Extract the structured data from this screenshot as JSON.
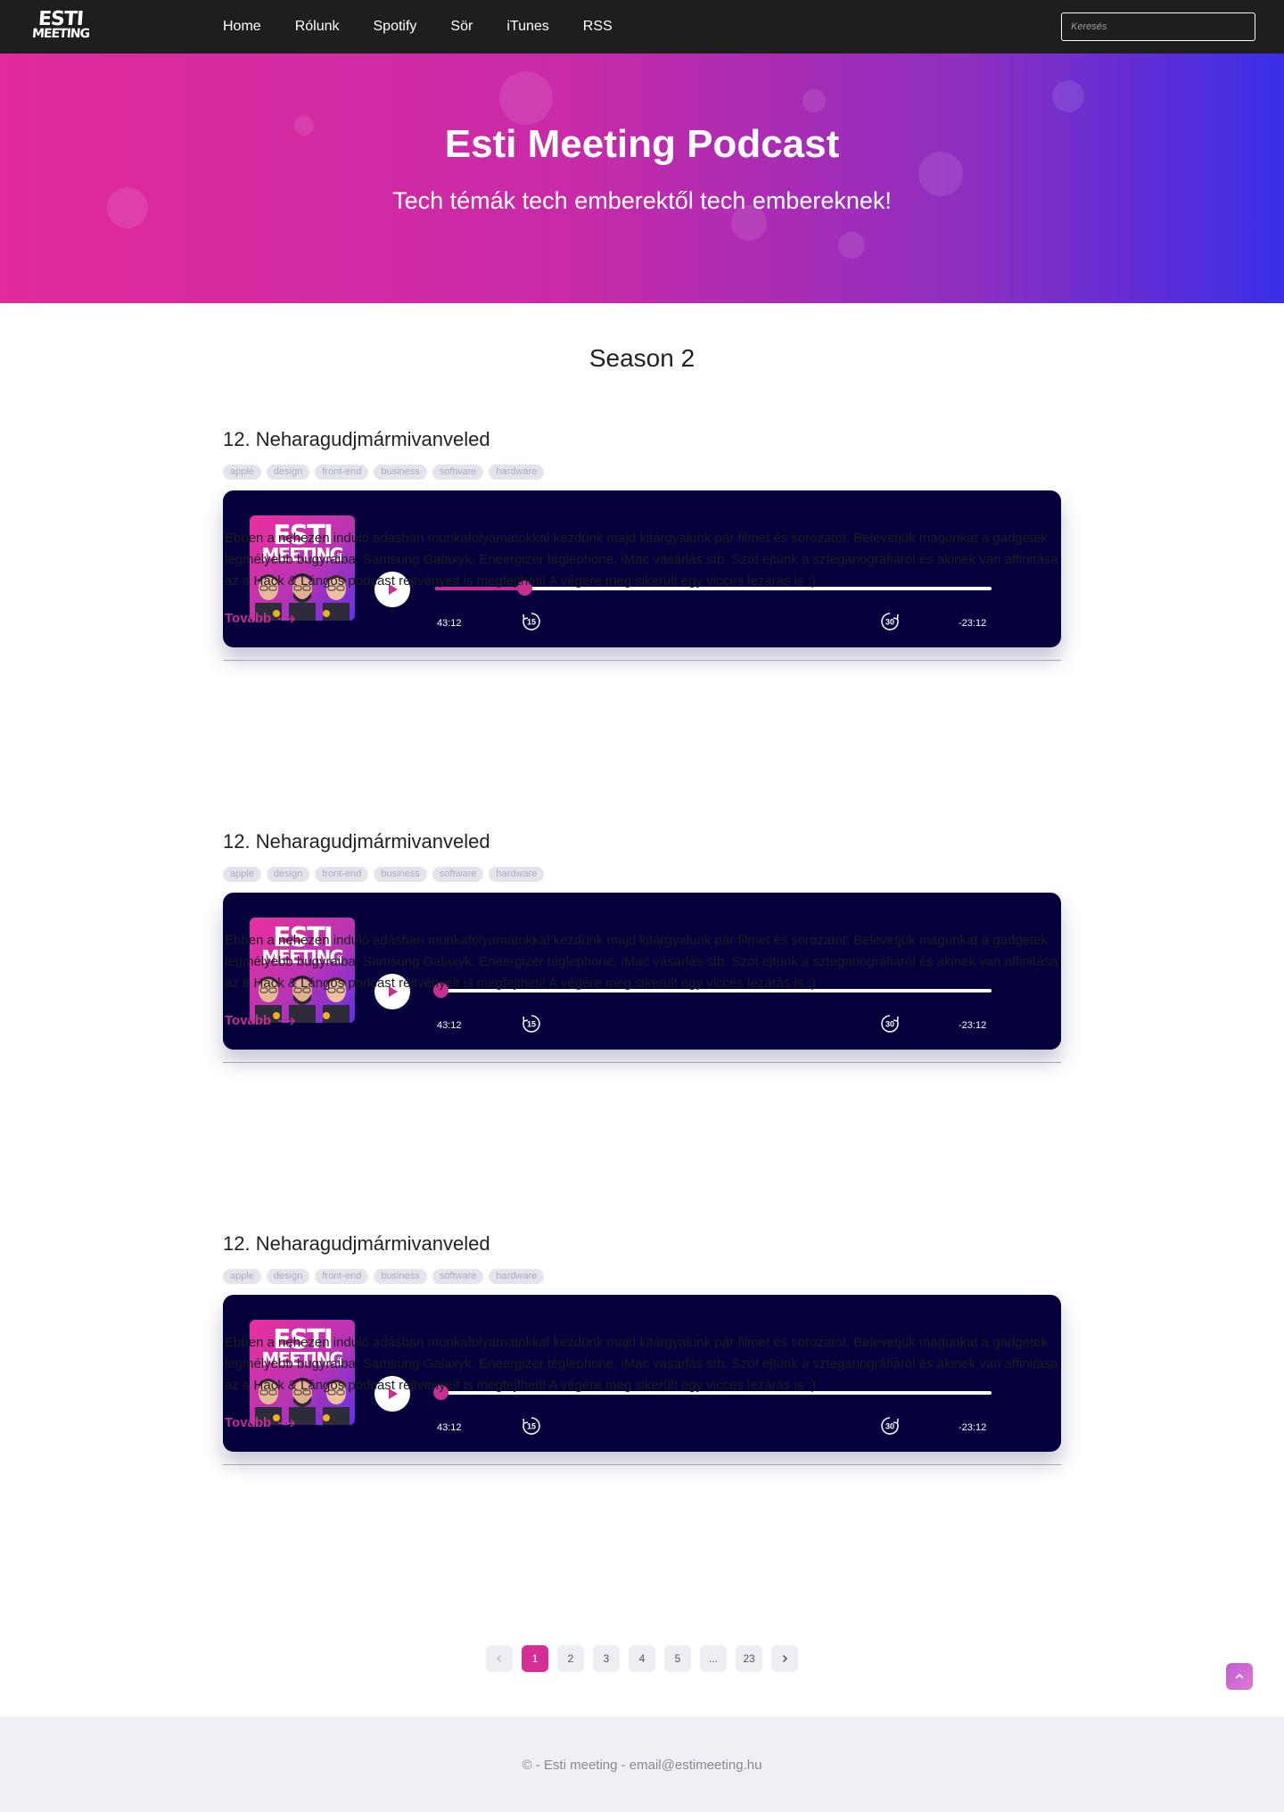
{
  "nav": {
    "logo_line1": "ESTI",
    "logo_line2": "MEETING",
    "links": [
      "Home",
      "Rólunk",
      "Spotify",
      "Sör",
      "iTunes",
      "RSS"
    ],
    "search_placeholder": "Keresés"
  },
  "hero": {
    "title": "Esti Meeting Podcast",
    "subtitle": "Tech témák tech emberektől tech embereknek!"
  },
  "season": "Season 2",
  "episodes": [
    {
      "title": "12. Neharagudjmármivanveled",
      "tags": [
        "apple",
        "design",
        "front-end",
        "business",
        "software",
        "hardware"
      ],
      "cover_line1": "ESTI",
      "cover_line2": "MEETING",
      "current_time": "43:12",
      "remaining_time": "-23:12",
      "skip_back": "15",
      "skip_forward": "30",
      "progress": 0.16,
      "description": "Ebben a nehezen induló adásban munkafolyamatokkal kezdünk majd kitárgyalunk pár filmet és sorozatot. Belevetjük magunkat a gadgetek legmélyebb bugyraiba: Samsung Galaxyk, Eneergizer téglephone, iMac vásárlás stb. Szót ejtünk a szteganográfiáról és akinek van affinitása az a Hack & Lángos podcast rejtvényeit is megfejtheti! A végére meg sikerült egy vicces lezárás is :)",
      "more_label": "Tovább"
    },
    {
      "title": "12. Neharagudjmármivanveled",
      "tags": [
        "apple",
        "design",
        "front-end",
        "business",
        "software",
        "hardware"
      ],
      "cover_line1": "ESTI",
      "cover_line2": "MEETING",
      "current_time": "43:12",
      "remaining_time": "-23:12",
      "skip_back": "15",
      "skip_forward": "30",
      "progress": 0.01,
      "description": "Ebben a nehezen induló adásban munkafolyamatokkal kezdünk majd kitárgyalunk pár filmet és sorozatot. Belevetjük magunkat a gadgetek legmélyebb bugyraiba: Samsung Galaxyk, Eneergizer téglephone, iMac vásárlás stb. Szót ejtünk a szteganográfiáról és akinek van affinitása az a Hack & Lángos podcast rejtvényeit is megfejtheti! A végére meg sikerült egy vicces lezárás is :)",
      "more_label": "Tovább"
    },
    {
      "title": "12. Neharagudjmármivanveled",
      "tags": [
        "apple",
        "design",
        "front-end",
        "business",
        "software",
        "hardware"
      ],
      "cover_line1": "ESTI",
      "cover_line2": "MEETING",
      "current_time": "43:12",
      "remaining_time": "-23:12",
      "skip_back": "15",
      "skip_forward": "30",
      "progress": 0.01,
      "description": "Ebben a nehezen induló adásban munkafolyamatokkal kezdünk majd kitárgyalunk pár filmet és sorozatot. Belevetjük magunkat a gadgetek legmélyebb bugyraiba: Samsung Galaxyk, Eneergizer téglephone, iMac vásárlás stb. Szót ejtünk a szteganográfiáról és akinek van affinitása az a Hack & Lángos podcast rejtvényeit is megfejtheti! A végére meg sikerült egy vicces lezárás is :)",
      "more_label": "Tovább"
    }
  ],
  "pagination": {
    "pages": [
      "1",
      "2",
      "3",
      "4",
      "5",
      "...",
      "23"
    ],
    "active": "1",
    "prev_icon": "chevron-left-icon",
    "next_icon": "chevron-right-icon"
  },
  "footer": {
    "text": "© - Esti meeting - email@estimeeting.hu"
  },
  "colors": {
    "accent": "#c62f8f",
    "player_bg": "#03003c",
    "nav_bg": "#1e1e1e",
    "hero_start": "#e12a9c",
    "hero_end": "#3a2ee6"
  }
}
